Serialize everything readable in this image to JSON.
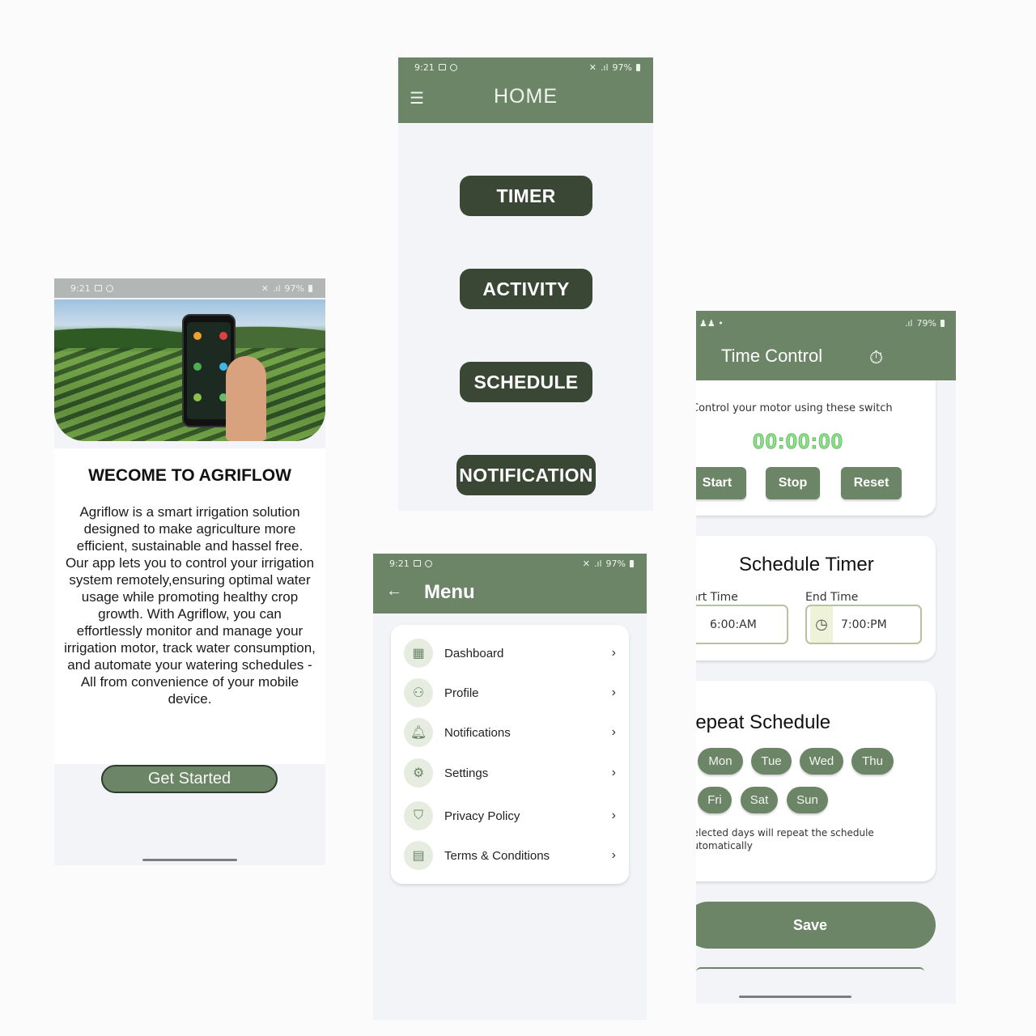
{
  "welcome": {
    "status": {
      "time": "9:21",
      "battery": "97%"
    },
    "title": "WECOME TO AGRIFLOW",
    "description": "Agriflow is a smart irrigation solution designed to make agriculture more efficient, sustainable and hassel free. Our app lets you to control your irrigation system remotely,ensuring optimal water usage while promoting healthy crop growth. With Agriflow, you can effortlessly monitor and manage your irrigation motor, track water consumption, and automate your watering schedules -All from convenience of your mobile device.",
    "button": "Get Started"
  },
  "home": {
    "status": {
      "time": "9:21",
      "battery": "97%"
    },
    "title": "HOME",
    "buttons": [
      "TIMER",
      "ACTIVITY",
      "SCHEDULE",
      "NOTIFICATION"
    ]
  },
  "menu": {
    "status": {
      "time": "9:21",
      "battery": "97%"
    },
    "title": "Menu",
    "items": [
      {
        "label": "Dashboard",
        "icon": "grid-icon"
      },
      {
        "label": "Profile",
        "icon": "person-icon"
      },
      {
        "label": "Notifications",
        "icon": "bell-icon"
      },
      {
        "label": "Settings",
        "icon": "gear-icon"
      },
      {
        "label": "Privacy Policy",
        "icon": "shield-icon"
      },
      {
        "label": "Terms & Conditions",
        "icon": "document-icon"
      }
    ]
  },
  "time_control": {
    "status": {
      "battery": "79%"
    },
    "title": "Time Control",
    "hint": "Control your motor using these switch",
    "clock": "00:00:00",
    "controls": [
      "Start",
      "Stop",
      "Reset"
    ],
    "schedule_title": "Schedule Timer",
    "start_label": "Start Time",
    "start_value": "6:00:AM",
    "end_label": "End Time",
    "end_value": "7:00:PM",
    "repeat_title": "Repeat Schedule",
    "days": [
      "Mon",
      "Tue",
      "Wed",
      "Thu",
      "Fri",
      "Sat",
      "Sun"
    ],
    "note_line1": "Selected days will repeat the schedule",
    "note_line2": "automatically",
    "save": "Save"
  },
  "colors": {
    "primary": "#6c8567",
    "dark_button": "#3a4734",
    "background": "#f2f4f8",
    "timer_green": "#8fe08b"
  }
}
